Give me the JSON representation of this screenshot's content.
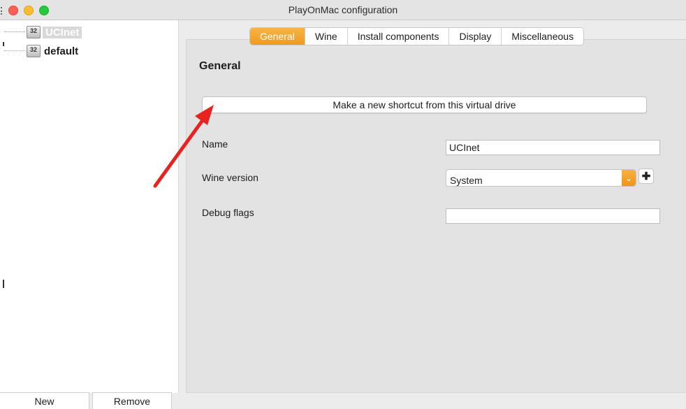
{
  "window": {
    "title": "PlayOnMac configuration"
  },
  "sidebar": {
    "items": [
      {
        "label": "UCInet",
        "icon": "32",
        "selected": true
      },
      {
        "label": "default",
        "icon": "32",
        "selected": false
      }
    ],
    "buttons": {
      "new": "New",
      "remove": "Remove"
    }
  },
  "tabs": [
    {
      "label": "General",
      "active": true
    },
    {
      "label": "Wine",
      "active": false
    },
    {
      "label": "Install components",
      "active": false
    },
    {
      "label": "Display",
      "active": false
    },
    {
      "label": "Miscellaneous",
      "active": false
    }
  ],
  "general": {
    "heading": "General",
    "shortcut_button": "Make a new shortcut from this virtual drive",
    "name_label": "Name",
    "name_value": "UCInet",
    "wine_version_label": "Wine version",
    "wine_version_value": "System",
    "debug_flags_label": "Debug flags",
    "debug_flags_value": ""
  },
  "colors": {
    "accent": "#f0a02a",
    "annotation_arrow": "#e8231f"
  }
}
